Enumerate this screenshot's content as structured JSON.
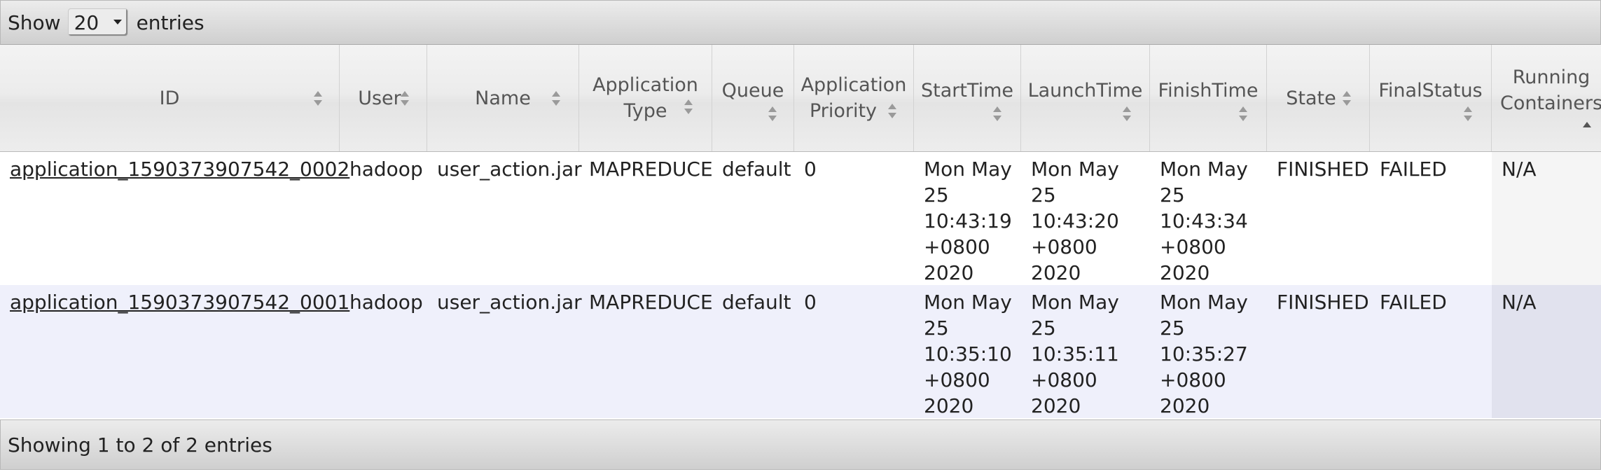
{
  "toolbar": {
    "show_label": "Show",
    "page_size": "20",
    "entries_label": "entries"
  },
  "columns": [
    {
      "label": "ID"
    },
    {
      "label": "User"
    },
    {
      "label": "Name"
    },
    {
      "label": "Application Type",
      "l1": "Application",
      "l2": "Type"
    },
    {
      "label": "Queue"
    },
    {
      "label": "Application Priority",
      "l1": "Application",
      "l2": "Priority"
    },
    {
      "label": "StartTime"
    },
    {
      "label": "LaunchTime"
    },
    {
      "label": "FinishTime"
    },
    {
      "label": "State"
    },
    {
      "label": "FinalStatus"
    },
    {
      "label": "Running Containers",
      "l1": "Running",
      "l2": "Containers"
    }
  ],
  "rows": [
    {
      "id": "application_1590373907542_0002",
      "user": "hadoop",
      "name": "user_action.jar",
      "type": "MAPREDUCE",
      "queue": "default",
      "priority": "0",
      "start": [
        "Mon May",
        "25",
        "10:43:19",
        "+0800",
        "2020"
      ],
      "launch": [
        "Mon May",
        "25",
        "10:43:20",
        "+0800",
        "2020"
      ],
      "finish": [
        "Mon May",
        "25",
        "10:43:34",
        "+0800",
        "2020"
      ],
      "state": "FINISHED",
      "final_status": "FAILED",
      "running_containers": "N/A"
    },
    {
      "id": "application_1590373907542_0001",
      "user": "hadoop",
      "name": "user_action.jar",
      "type": "MAPREDUCE",
      "queue": "default",
      "priority": "0",
      "start": [
        "Mon May",
        "25",
        "10:35:10",
        "+0800",
        "2020"
      ],
      "launch": [
        "Mon May",
        "25",
        "10:35:11",
        "+0800",
        "2020"
      ],
      "finish": [
        "Mon May",
        "25",
        "10:35:27",
        "+0800",
        "2020"
      ],
      "state": "FINISHED",
      "final_status": "FAILED",
      "running_containers": "N/A"
    }
  ],
  "footer": {
    "info": "Showing 1 to 2 of 2 entries"
  }
}
